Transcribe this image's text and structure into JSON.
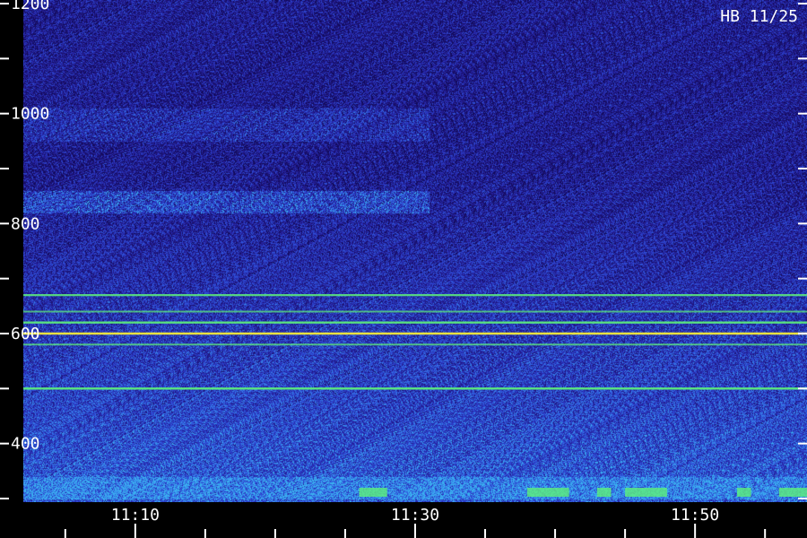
{
  "chart_data": {
    "type": "heatmap",
    "title": "HB 11/25",
    "xlabel": "",
    "ylabel": "",
    "x_unit": "time",
    "xlim": [
      "11:02",
      "11:58"
    ],
    "ylim": [
      300,
      1200
    ],
    "y_major_ticks": [
      400,
      600,
      800,
      1000,
      1200
    ],
    "y_minor_ticks": [
      300,
      500,
      700,
      900,
      1100
    ],
    "y_tick_labels": [
      "400",
      "600",
      "800",
      "1000",
      "1200"
    ],
    "x_major_ticks": [
      "11:10",
      "11:30",
      "11:50"
    ],
    "x_tick_labels": [
      "11:10",
      "11:30",
      "11:50"
    ],
    "x_minor_ticks": [
      "11:05",
      "11:15",
      "11:20",
      "11:25",
      "11:35",
      "11:40",
      "11:45",
      "11:55"
    ],
    "grid": false,
    "colors": {
      "background": "#2a1c8a",
      "low": "#1a1070",
      "mid": "#2f52d8",
      "high": "#3ab0f0",
      "line": "#5ef07a",
      "peak": "#e8e040",
      "axis": "#ffffff",
      "text": "#ffffff"
    },
    "lines": [
      {
        "y": 670,
        "strength": 0.75
      },
      {
        "y": 640,
        "strength": 0.5
      },
      {
        "y": 620,
        "strength": 0.85
      },
      {
        "y": 600,
        "strength": 1.0
      },
      {
        "y": 580,
        "strength": 0.55
      },
      {
        "y": 500,
        "strength": 0.9
      }
    ],
    "bands": [
      {
        "y_from": 820,
        "y_to": 860,
        "x_from": "11:02",
        "x_to": "11:31",
        "strength": 0.45
      },
      {
        "y_from": 950,
        "y_to": 1010,
        "x_from": "11:02",
        "x_to": "11:31",
        "strength": 0.25
      },
      {
        "y_from": 300,
        "y_to": 340,
        "x_from": "11:02",
        "x_to": "11:58",
        "strength": 0.35
      }
    ]
  }
}
